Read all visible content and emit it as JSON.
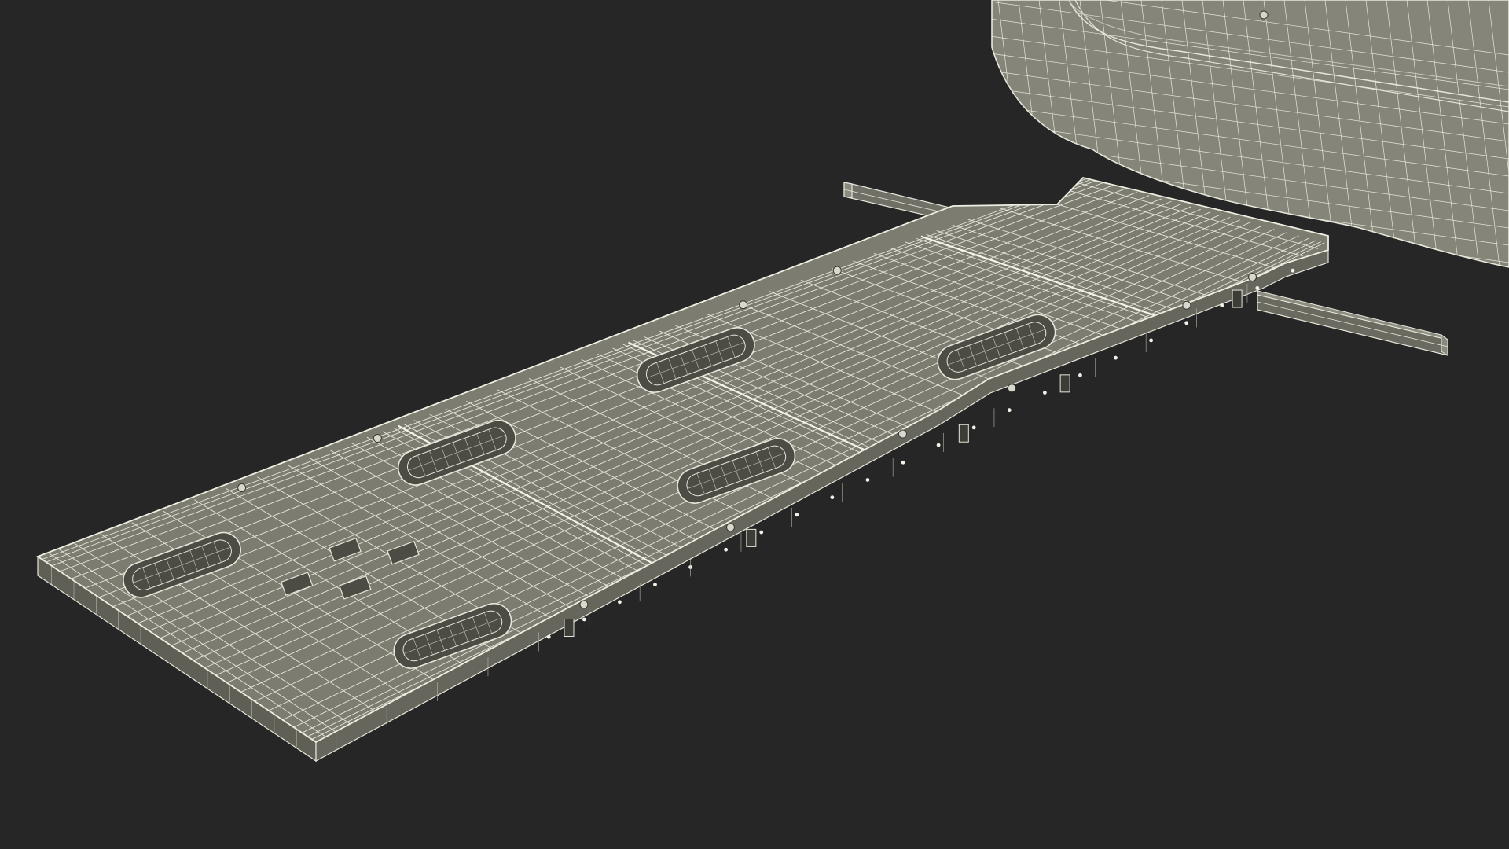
{
  "scene": {
    "subject": "wireframe-render",
    "colors": {
      "background": "#262626",
      "surface": "#7b7b70",
      "surface_light": "#8a8a7f",
      "surface_side": "#5f5f56",
      "hole": "#4c4c45",
      "wire": "#e6e6da",
      "wire_dim": "#b8b8ac"
    }
  }
}
